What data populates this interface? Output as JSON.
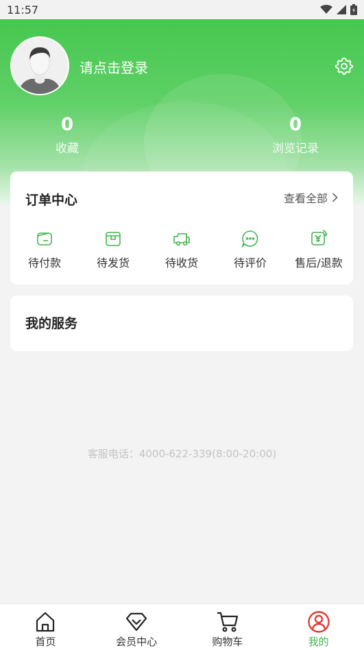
{
  "status_bar": {
    "time": "11:57"
  },
  "header": {
    "login_prompt": "请点击登录",
    "stats": [
      {
        "value": "0",
        "label": "收藏"
      },
      {
        "value": "0",
        "label": "浏览记录"
      }
    ]
  },
  "order_center": {
    "title": "订单中心",
    "view_all": "查看全部",
    "items": [
      {
        "label": "待付款",
        "icon": "wallet-icon"
      },
      {
        "label": "待发货",
        "icon": "package-icon"
      },
      {
        "label": "待收货",
        "icon": "truck-icon"
      },
      {
        "label": "待评价",
        "icon": "comment-icon"
      },
      {
        "label": "售后/退款",
        "icon": "refund-icon"
      }
    ]
  },
  "services": {
    "title": "我的服务"
  },
  "hotline": "客服电话：4000-622-339(8:00-20:00)",
  "tabbar": {
    "items": [
      {
        "label": "首页",
        "icon": "home-icon"
      },
      {
        "label": "会员中心",
        "icon": "diamond-icon"
      },
      {
        "label": "购物车",
        "icon": "cart-icon"
      },
      {
        "label": "我的",
        "icon": "user-circle-icon",
        "active": true
      }
    ]
  },
  "colors": {
    "accent": "#46c750",
    "active_tab": "#e53935"
  }
}
